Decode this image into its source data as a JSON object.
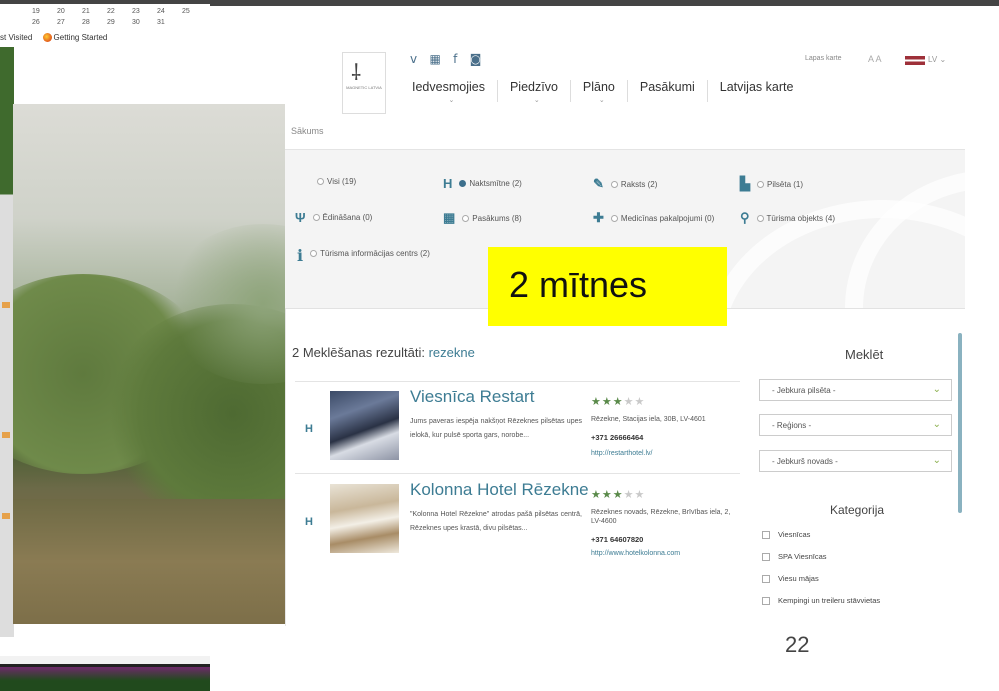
{
  "browser": {
    "calendar": {
      "row1": [
        "19",
        "20",
        "21",
        "22",
        "23",
        "24",
        "25"
      ],
      "row2": [
        "26",
        "27",
        "28",
        "29",
        "30",
        "31"
      ]
    },
    "bookmarks": {
      "most_visited": "st Visited",
      "getting_started": "Getting Started"
    }
  },
  "header": {
    "logo_text": "MAGNETIC LATVIA",
    "social_icons": [
      "vimeo-icon",
      "youtube-icon",
      "facebook-icon",
      "instagram-icon"
    ],
    "social_glyphs": [
      "v",
      "▦",
      "f",
      "◙"
    ],
    "nav": [
      {
        "label": "Iedvesmojies",
        "has_dropdown": true
      },
      {
        "label": "Piedzīvo",
        "has_dropdown": true
      },
      {
        "label": "Plāno",
        "has_dropdown": true
      },
      {
        "label": "Pasākumi",
        "has_dropdown": false
      },
      {
        "label": "Latvijas karte",
        "has_dropdown": false
      }
    ],
    "site_map_link": "Lapas karte",
    "font_size_label": "A A",
    "language": "LV"
  },
  "breadcrumb": "Sākums",
  "filters": [
    {
      "icon": "",
      "label": "Visi (19)",
      "selected": false
    },
    {
      "icon": "H",
      "label": "Naktsmītne (2)",
      "selected": true
    },
    {
      "icon": "✎",
      "label": "Raksts (2)",
      "selected": false
    },
    {
      "icon": "▙",
      "label": "Pilsēta (1)",
      "selected": false
    },
    {
      "icon": "Ψ",
      "label": "Ēdināšana (0)",
      "selected": false
    },
    {
      "icon": "▦",
      "label": "Pasākums (8)",
      "selected": false
    },
    {
      "icon": "✚",
      "label": "Medicīnas pakalpojumi (0)",
      "selected": false
    },
    {
      "icon": "⚲",
      "label": "Tūrisma objekts (4)",
      "selected": false
    },
    {
      "icon": "i",
      "label": "Tūrisma informācijas centrs (2)",
      "selected": false
    }
  ],
  "overlay_label": "2 mītnes",
  "results": {
    "count_prefix": "2 Meklēšanas rezultāti:",
    "query": "rezekne",
    "items": [
      {
        "marker": "H",
        "name": "Viesnīca Restart",
        "description": "Jums paveras iespēja nakšņot Rēzeknes pilsētas upes ielokā, kur pulsē sporta gars, norobe...",
        "stars": 3,
        "max_stars": 5,
        "address": "Rēzekne, Stacijas iela, 30B, LV-4601",
        "phone": "+371 26666464",
        "url": "http://restarthotel.lv/"
      },
      {
        "marker": "H",
        "name": "Kolonna Hotel Rēzekne",
        "description": "\"Kolonna Hotel Rēzekne\" atrodas pašā pilsētas centrā, Rēzeknes upes krastā, divu pilsētas...",
        "stars": 3,
        "max_stars": 5,
        "address": "Rēzeknes novads, Rēzekne, Brīvības iela, 2, LV-4600",
        "phone": "+371 64607820",
        "url": "http://www.hotelkolonna.com"
      }
    ]
  },
  "sidebar": {
    "search_title": "Meklēt",
    "selects": [
      "- Jebkura pilsēta -",
      "- Reģions -",
      "- Jebkurš novads -"
    ],
    "category_title": "Kategorija",
    "categories": [
      "Viesnīcas",
      "SPA Viesnīcas",
      "Viesu mājas",
      "Kempingi un treileru stāvvietas"
    ]
  },
  "page_number": "22",
  "colors": {
    "accent": "#3d7c93",
    "stars": "#5a8a4a",
    "overlay": "#ffff00",
    "select_chevron": "#8cb04e"
  }
}
